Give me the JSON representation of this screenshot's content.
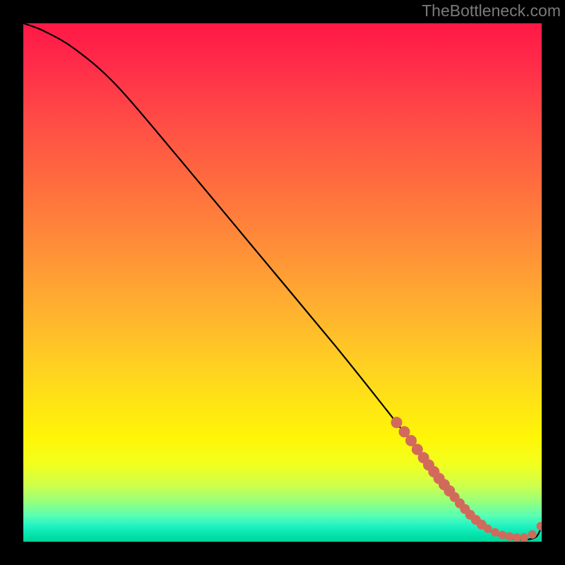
{
  "watermark": "TheBottleneck.com",
  "chart_data": {
    "type": "line",
    "title": "",
    "xlabel": "",
    "ylabel": "",
    "xlim": [
      0,
      1
    ],
    "ylim": [
      0,
      1
    ],
    "series": [
      {
        "name": "bottleneck-curve",
        "kind": "line",
        "x": [
          0.0,
          0.04,
          0.1,
          0.18,
          0.3,
          0.45,
          0.6,
          0.7,
          0.78,
          0.83,
          0.87,
          0.905,
          0.94,
          0.97,
          0.99,
          1.0
        ],
        "y": [
          1.0,
          0.985,
          0.95,
          0.88,
          0.74,
          0.56,
          0.38,
          0.255,
          0.152,
          0.09,
          0.045,
          0.018,
          0.006,
          0.004,
          0.01,
          0.03
        ]
      },
      {
        "name": "highlighted-points",
        "kind": "scatter",
        "x": [
          0.72,
          0.735,
          0.748,
          0.76,
          0.772,
          0.782,
          0.792,
          0.802,
          0.812,
          0.822,
          0.832,
          0.842,
          0.852,
          0.862,
          0.873,
          0.884,
          0.896,
          0.91,
          0.924,
          0.938,
          0.952,
          0.966,
          0.982,
          0.998
        ],
        "y": [
          0.23,
          0.212,
          0.195,
          0.178,
          0.162,
          0.148,
          0.135,
          0.122,
          0.11,
          0.098,
          0.086,
          0.074,
          0.063,
          0.052,
          0.042,
          0.033,
          0.025,
          0.018,
          0.013,
          0.01,
          0.008,
          0.008,
          0.014,
          0.03
        ],
        "r": [
          8,
          8,
          8,
          8,
          8,
          8,
          8,
          8,
          8,
          8,
          7,
          7,
          7,
          7,
          7,
          7,
          6,
          6,
          6,
          6,
          6,
          6,
          6,
          6
        ]
      }
    ],
    "background_gradient": {
      "top": "#ff1846",
      "mid": "#ffe810",
      "bottom": "#00d49a"
    }
  }
}
